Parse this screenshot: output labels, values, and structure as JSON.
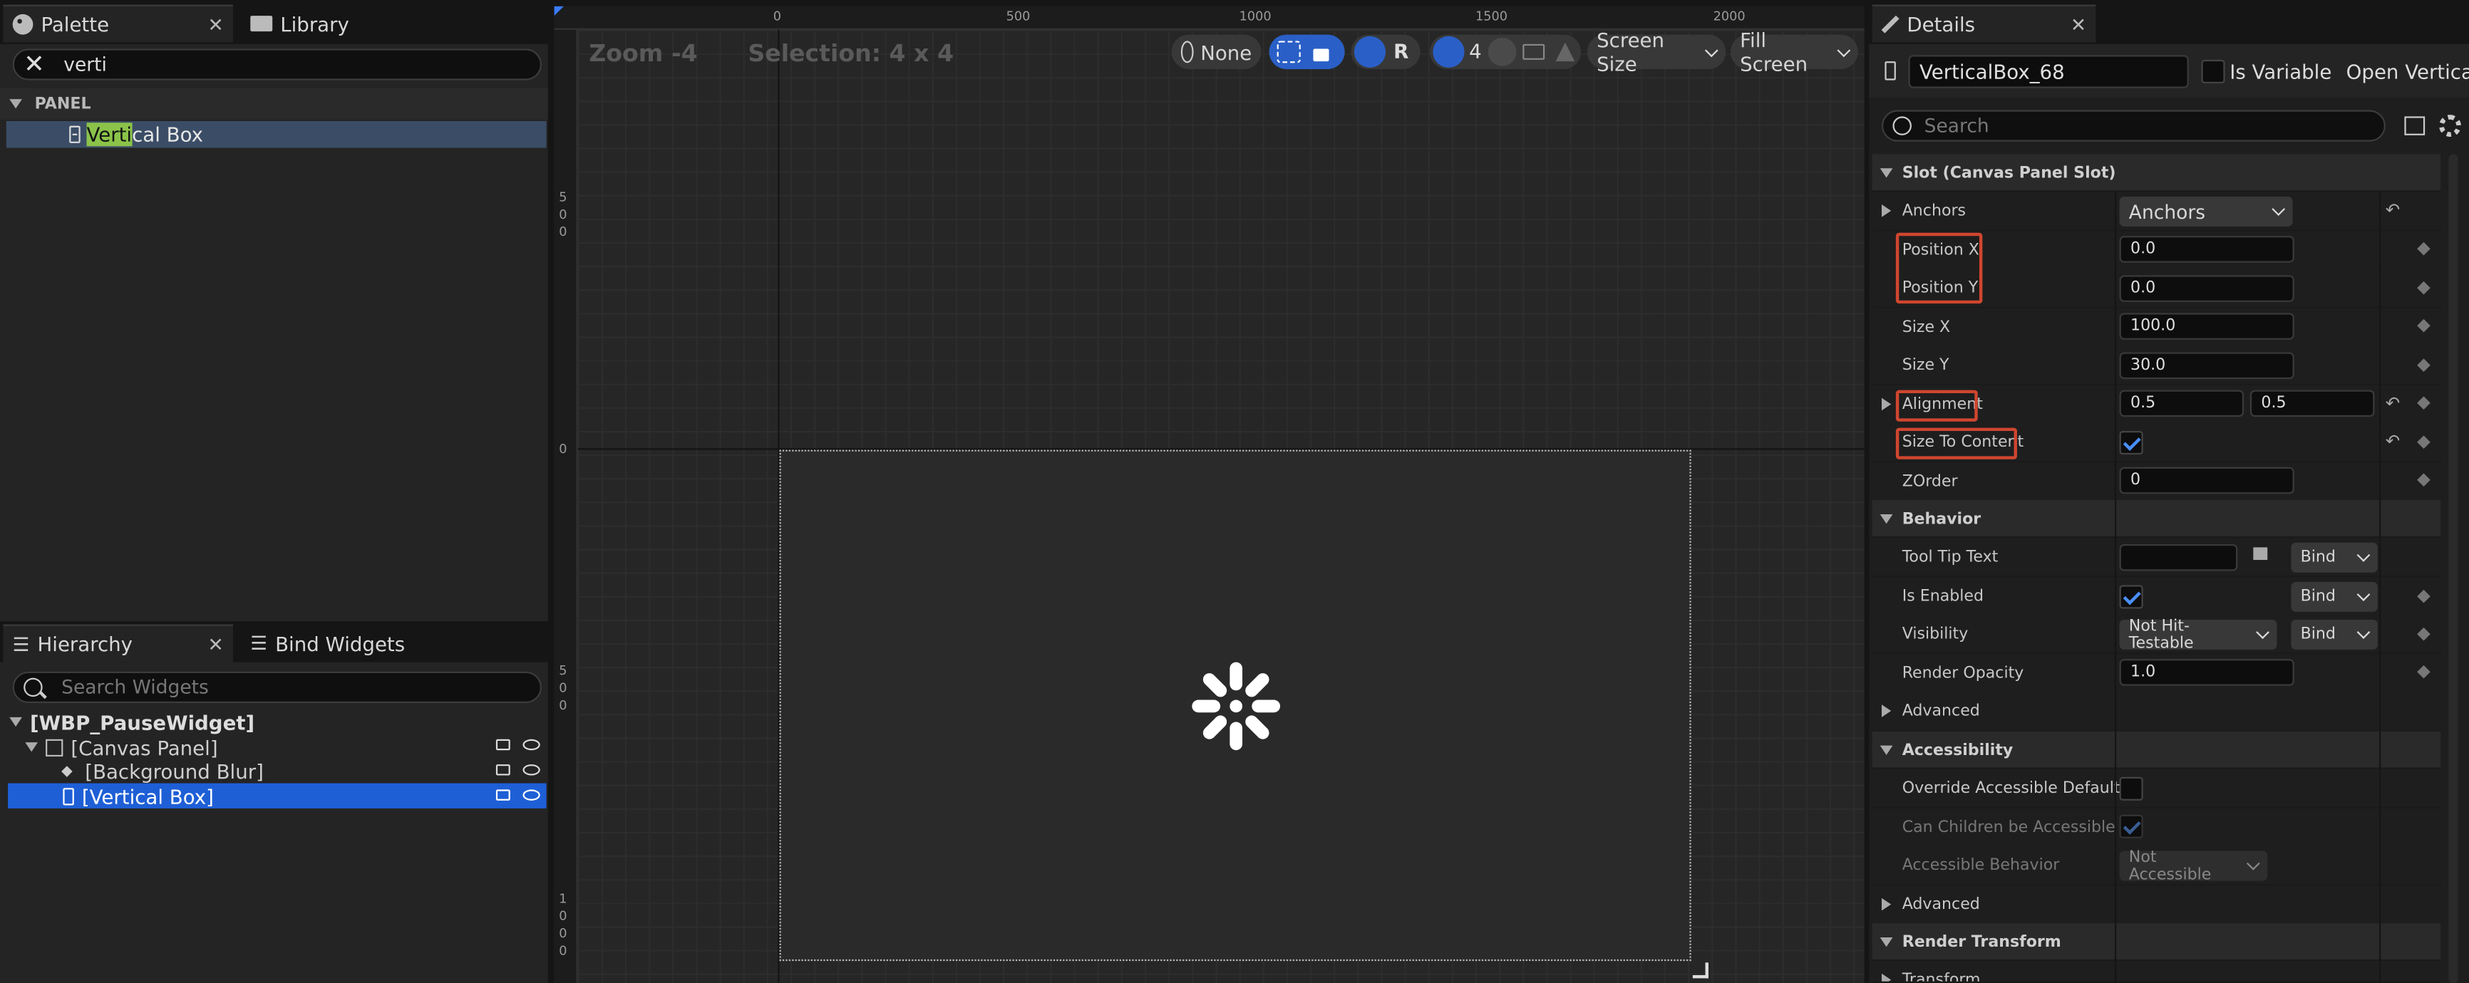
{
  "palette": {
    "tab_label": "Palette",
    "library_label": "Library",
    "search_value": "verti",
    "section_label": "PANEL",
    "result_highlight": "Verti",
    "result_rest": "cal Box"
  },
  "hierarchy": {
    "tab_label": "Hierarchy",
    "bind_tab_label": "Bind Widgets",
    "search_placeholder": "Search Widgets",
    "items": [
      {
        "label": "[WBP_PauseWidget]"
      },
      {
        "label": "[Canvas Panel]"
      },
      {
        "label": "[Background Blur]"
      },
      {
        "label": "[Vertical Box]"
      }
    ]
  },
  "designer": {
    "zoom": "Zoom -4",
    "selection": "Selection: 4 x 4",
    "none_label": "None",
    "r_label": "R",
    "grid_value": "4",
    "screen_size": "Screen Size",
    "fill_screen": "Fill Screen",
    "ruler_top": [
      "0",
      "500",
      "1000",
      "1500",
      "2000"
    ],
    "ruler_left": [
      "500",
      "0",
      "500",
      "1000"
    ]
  },
  "details": {
    "tab_label": "Details",
    "widget_name": "VerticalBox_68",
    "is_variable": "Is Variable",
    "open_link": "Open VerticalB",
    "search_placeholder": "Search",
    "categories": {
      "slot": "Slot (Canvas Panel Slot)",
      "behavior": "Behavior",
      "accessibility": "Accessibility",
      "render": "Render Transform"
    },
    "rows": {
      "anchors": {
        "label": "Anchors",
        "value": "Anchors"
      },
      "pos_x": {
        "label": "Position X",
        "value": "0.0"
      },
      "pos_y": {
        "label": "Position Y",
        "value": "0.0"
      },
      "size_x": {
        "label": "Size X",
        "value": "100.0"
      },
      "size_y": {
        "label": "Size Y",
        "value": "30.0"
      },
      "alignment": {
        "label": "Alignment",
        "value1": "0.5",
        "value2": "0.5"
      },
      "size_to_content": {
        "label": "Size To Content"
      },
      "zorder": {
        "label": "ZOrder",
        "value": "0"
      },
      "tooltip": {
        "label": "Tool Tip Text",
        "bind": "Bind"
      },
      "enabled": {
        "label": "Is Enabled",
        "bind": "Bind"
      },
      "visibility": {
        "label": "Visibility",
        "value": "Not Hit-Testable",
        "bind": "Bind"
      },
      "opacity": {
        "label": "Render Opacity",
        "value": "1.0"
      },
      "advanced1": {
        "label": "Advanced"
      },
      "override": {
        "label": "Override Accessible Defaults"
      },
      "children": {
        "label": "Can Children be Accessible"
      },
      "acc_behavior": {
        "label": "Accessible Behavior",
        "value": "Not Accessible"
      },
      "advanced2": {
        "label": "Advanced"
      },
      "transform": {
        "label": "Transform"
      }
    }
  },
  "colors": {
    "selection_blue": "#1e5fd6",
    "highlight_red": "#d0462f",
    "search_highlight": "#8bc34a"
  }
}
